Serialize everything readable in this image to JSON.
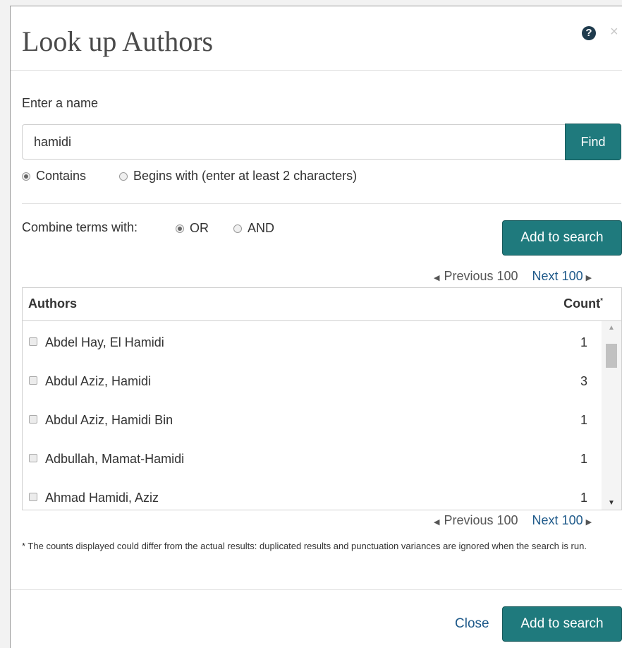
{
  "dialog": {
    "title": "Look up Authors",
    "help_icon": "question-circle-icon",
    "close_icon": "close-icon",
    "close_glyph": "×"
  },
  "search": {
    "label": "Enter a name",
    "value": "hamidi",
    "find_label": "Find",
    "match_mode": {
      "contains_label": "Contains",
      "begins_label": "Begins with (enter at least 2 characters)",
      "selected": "contains"
    }
  },
  "combine": {
    "label": "Combine terms with:",
    "or_label": "OR",
    "and_label": "AND",
    "selected": "or"
  },
  "add_to_search_label": "Add to search",
  "pager": {
    "prev_label": "Previous 100",
    "next_label": "Next 100"
  },
  "table": {
    "col_authors": "Authors",
    "col_count": "Count",
    "count_marker": "*",
    "rows": [
      {
        "name": "Abdel Hay, El Hamidi",
        "count": "1"
      },
      {
        "name": "Abdul Aziz, Hamidi",
        "count": "3"
      },
      {
        "name": "Abdul Aziz, Hamidi Bin",
        "count": "1"
      },
      {
        "name": "Adbullah, Mamat-Hamidi",
        "count": "1"
      },
      {
        "name": "Ahmad Hamidi, Aziz",
        "count": "1"
      }
    ]
  },
  "footnote": "* The counts displayed could differ from the actual results: duplicated results and punctuation variances are ignored when the search is run.",
  "footer": {
    "close_label": "Close"
  },
  "colors": {
    "accent": "#1f7a7d",
    "link": "#1f5a8a"
  }
}
